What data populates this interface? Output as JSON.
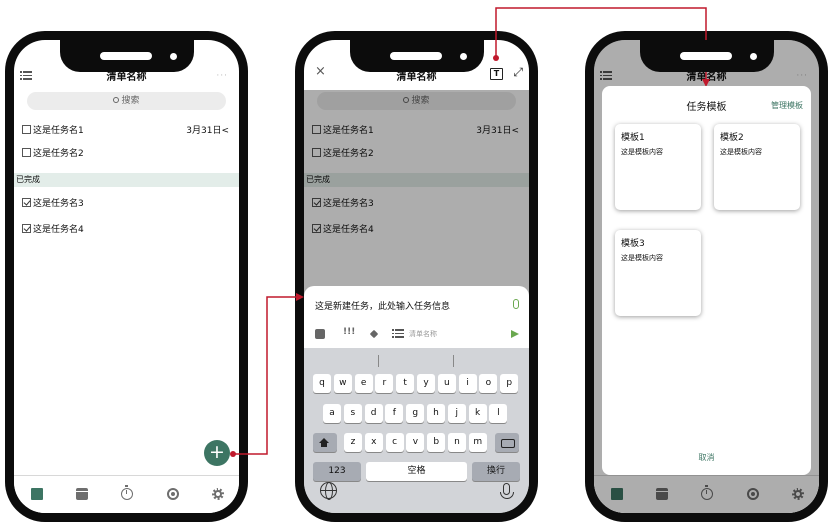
{
  "list": {
    "title": "清单名称",
    "search_placeholder": "搜索",
    "tasks": [
      {
        "name": "这是任务名1",
        "due": "3月31日",
        "checked": false
      },
      {
        "name": "这是任务名2",
        "checked": false
      }
    ],
    "completed_header": "已完成",
    "completed": [
      {
        "name": "这是任务名3",
        "checked": true
      },
      {
        "name": "这是任务名4",
        "checked": true
      }
    ],
    "fab_label": "+",
    "more_label": "···",
    "due_chevron": "<",
    "tabs": [
      "home-icon",
      "calendar-icon",
      "timer-icon",
      "location-icon",
      "settings-icon"
    ]
  },
  "editor": {
    "close_label": "×",
    "template_button_label": "T",
    "expand_label": "⤢",
    "input_text": "这是新建任务，此处输入任务信息",
    "priority_label": "!!!",
    "list_name_placeholder": "清单名称",
    "keyboard": {
      "row1": [
        "q",
        "w",
        "e",
        "r",
        "t",
        "y",
        "u",
        "i",
        "o",
        "p"
      ],
      "row2": [
        "a",
        "s",
        "d",
        "f",
        "g",
        "h",
        "j",
        "k",
        "l"
      ],
      "row3": [
        "z",
        "x",
        "c",
        "v",
        "b",
        "n",
        "m"
      ],
      "key_123": "123",
      "key_space": "空格",
      "key_return": "換行"
    }
  },
  "templates": {
    "title": "任务模板",
    "manage_label": "管理模板",
    "cards": [
      {
        "name": "模板1",
        "content": "这是模板内容"
      },
      {
        "name": "模板2",
        "content": "这是模板内容"
      },
      {
        "name": "模板3",
        "content": "这是模板内容"
      }
    ],
    "cancel_label": "取消"
  },
  "colors": {
    "accent": "#3d7563",
    "connector": "#c0192c",
    "send_green": "#6aa84f",
    "completed_bg": "#e3ede9"
  }
}
